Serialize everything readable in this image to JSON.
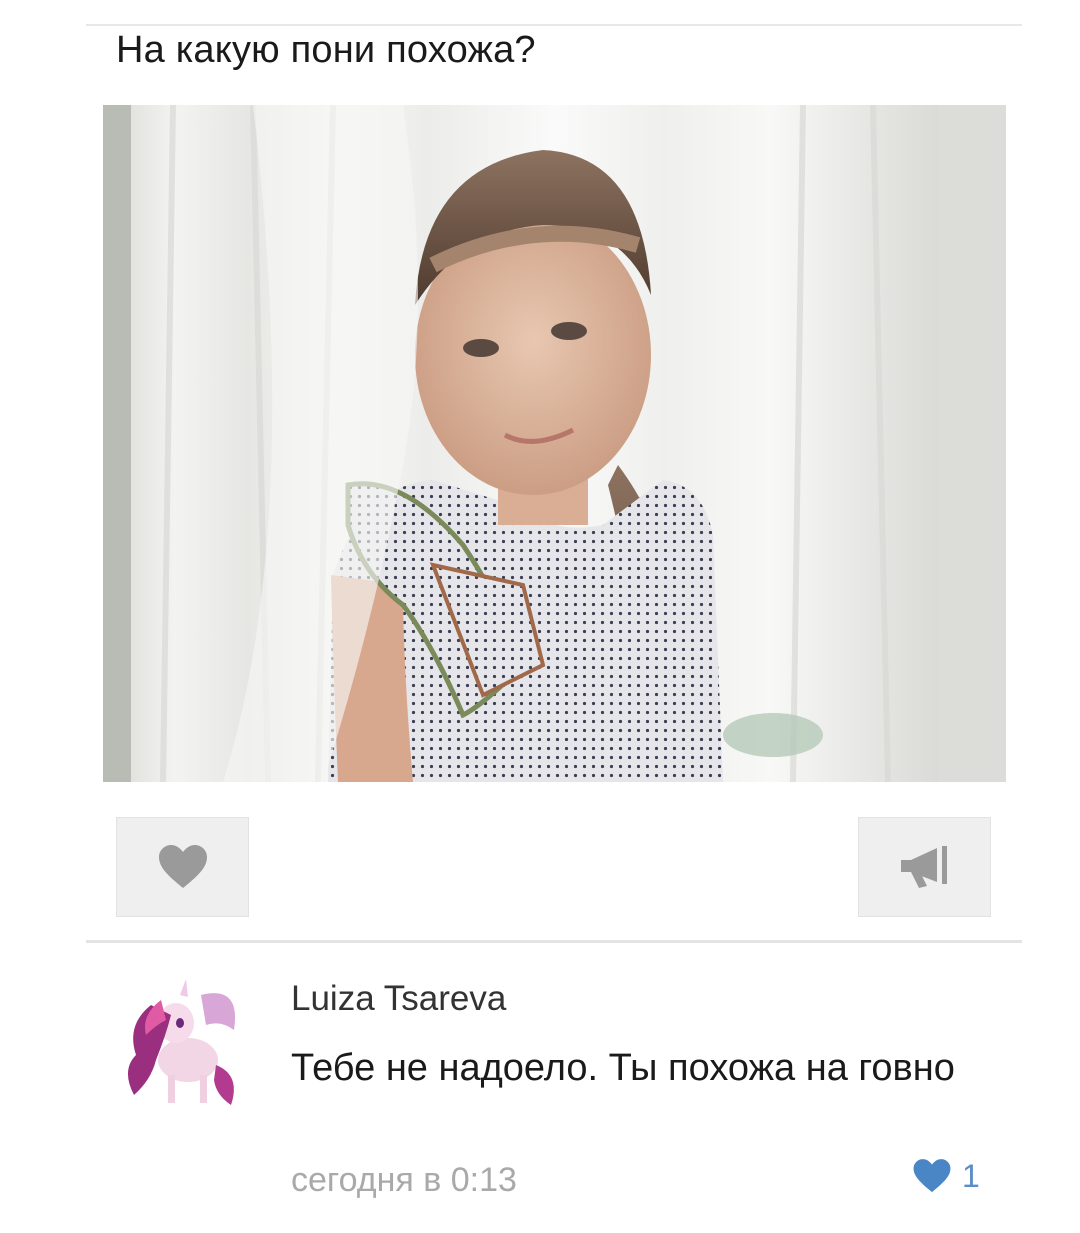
{
  "post": {
    "title": "На какую пони похожа?",
    "like_icon": "heart-icon",
    "share_icon": "megaphone-icon"
  },
  "comment": {
    "author": "Luiza Tsareva",
    "text": "Тебе не надоело. Ты похожа на говно",
    "time": "сегодня в 0:13",
    "likes": "1",
    "like_icon": "heart-icon",
    "like_color": "#4a86c5"
  }
}
